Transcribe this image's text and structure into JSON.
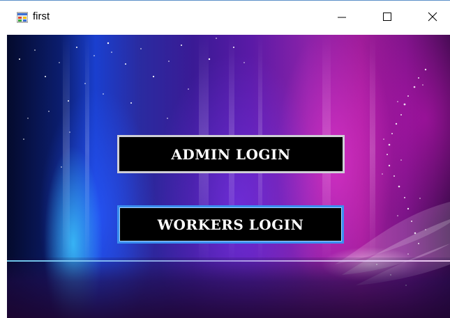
{
  "window": {
    "title": "first",
    "icons": {
      "app": "app-form-icon",
      "minimize": "minimize-icon",
      "maximize": "maximize-icon",
      "close": "close-icon"
    }
  },
  "main": {
    "admin_login_label": "ADMIN LOGIN",
    "workers_login_label": "WORKERS LOGIN"
  },
  "colors": {
    "admin_border": "#cfcfd6",
    "workers_border": "#3a8ff0",
    "button_bg": "#000000",
    "button_text": "#ffffff"
  }
}
